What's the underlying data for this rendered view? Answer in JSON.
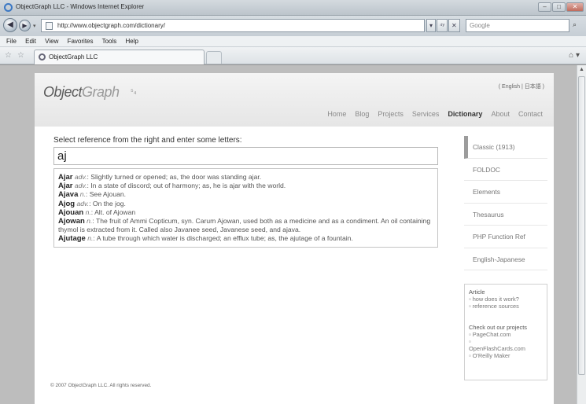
{
  "window": {
    "title": "ObjectGraph LLC - Windows Internet Explorer",
    "controls": [
      "–",
      "□",
      "✕"
    ]
  },
  "address": {
    "url": "http://www.objectgraph.com/dictionary/",
    "search_placeholder": "Google",
    "buttons": [
      "▾",
      "⁴ʸ",
      "✕"
    ]
  },
  "menu": [
    "File",
    "Edit",
    "View",
    "Favorites",
    "Tools",
    "Help"
  ],
  "tab": {
    "title": "ObjectGraph LLC"
  },
  "site": {
    "logo_part1": "Object",
    "logo_part2": "Graph",
    "logo_mark": "⁵₄",
    "language": "( English | 日本語 )",
    "nav": [
      {
        "label": "Home",
        "active": false
      },
      {
        "label": "Blog",
        "active": false
      },
      {
        "label": "Projects",
        "active": false
      },
      {
        "label": "Services",
        "active": false
      },
      {
        "label": "Dictionary",
        "active": true
      },
      {
        "label": "About",
        "active": false
      },
      {
        "label": "Contact",
        "active": false
      }
    ]
  },
  "dictionary": {
    "prompt": "Select reference from the right and enter some letters:",
    "query": "aj",
    "results": [
      {
        "word": "Ajar",
        "pos": "adv.",
        "def": ": Slightly turned or opened; as, the door was standing ajar."
      },
      {
        "word": "Ajar",
        "pos": "adv.",
        "def": ": In a state of discord; out of harmony; as, he is ajar with the world."
      },
      {
        "word": "Ajava",
        "pos": "n.",
        "def": ": See Ajouan."
      },
      {
        "word": "Ajog",
        "pos": "adv.",
        "def": ": On the jog."
      },
      {
        "word": "Ajouan",
        "pos": "n.",
        "def": ": Alt. of Ajowan"
      },
      {
        "word": "Ajowan",
        "pos": "n.",
        "def": ": The fruit of Ammi Copticum, syn. Carum Ajowan, used both as a medicine and as a condiment. An oil containing thymol is extracted from it. Called also Javanee seed, Javanese seed, and ajava."
      },
      {
        "word": "Ajutage",
        "pos": "n.",
        "def": ": A tube through which water is discharged; an efflux tube; as, the ajutage of a fountain."
      }
    ],
    "references": [
      {
        "label": "Classic (1913)",
        "active": true
      },
      {
        "label": "FOLDOC",
        "active": false
      },
      {
        "label": "Elements",
        "active": false
      },
      {
        "label": "Thesaurus",
        "active": false
      },
      {
        "label": "PHP Function Ref",
        "active": false
      },
      {
        "label": "English-Japanese",
        "active": false
      }
    ]
  },
  "sidebox": {
    "article_heading": "Article",
    "article_links": [
      "how does it work?",
      "reference sources"
    ],
    "projects_heading": "Check out our projects",
    "project_links": [
      "PageChat.com",
      "OpenFlashCards.com",
      "O'Reilly Maker"
    ]
  },
  "footer": "© 2007 ObjectGraph LLC. All rights reserved."
}
